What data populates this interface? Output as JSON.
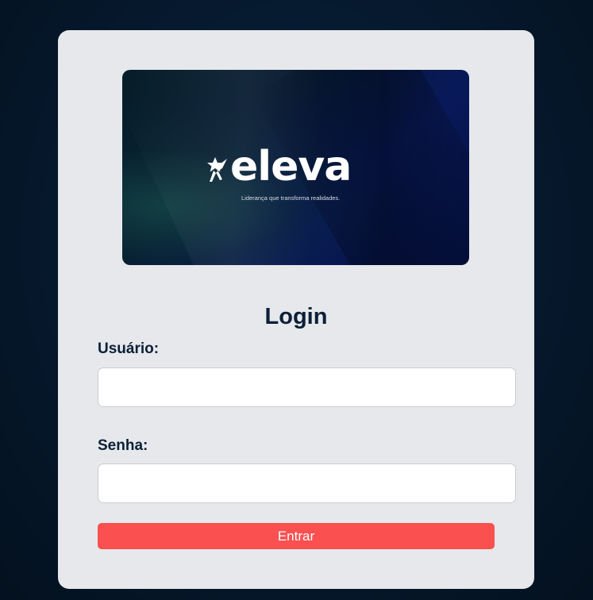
{
  "banner": {
    "brand": "eleva",
    "tagline": "Liderança que transforma realidades.",
    "logo_icon": "running-person-star-icon"
  },
  "login": {
    "title": "Login",
    "username_label": "Usuário:",
    "username_value": "",
    "password_label": "Senha:",
    "password_value": "",
    "submit_label": "Entrar"
  },
  "colors": {
    "background": "#061a30",
    "card": "#e6e8eb",
    "text": "#0c1f38",
    "button": "#fa5050",
    "button_text": "#ffffff"
  }
}
